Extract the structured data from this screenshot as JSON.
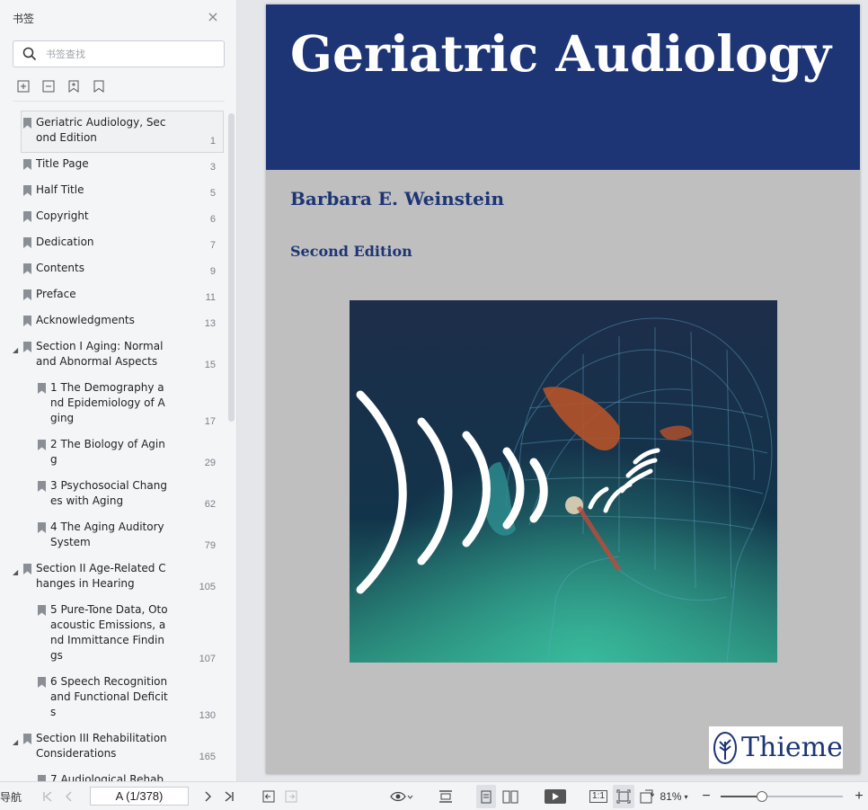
{
  "sidebar": {
    "title": "书签",
    "search_placeholder": "书签查找",
    "bookmarks": [
      {
        "label": "Geriatric Audiology, Second Edition",
        "page": "1",
        "level": 0,
        "selected": true,
        "expandable": false,
        "lines": 2
      },
      {
        "label": "Title Page",
        "page": "3",
        "level": 0,
        "lines": 1
      },
      {
        "label": "Half Title",
        "page": "5",
        "level": 0,
        "lines": 1
      },
      {
        "label": "Copyright",
        "page": "6",
        "level": 0,
        "lines": 1
      },
      {
        "label": "Dedication",
        "page": "7",
        "level": 0,
        "lines": 1
      },
      {
        "label": "Contents",
        "page": "9",
        "level": 0,
        "lines": 1
      },
      {
        "label": "Preface",
        "page": "11",
        "level": 0,
        "lines": 1
      },
      {
        "label": "Acknowledgments",
        "page": "13",
        "level": 0,
        "lines": 1
      },
      {
        "label": "Section I Aging: Normal and Abnormal Aspects",
        "page": "15",
        "level": 0,
        "expandable": true,
        "lines": 2
      },
      {
        "label": "1 The Demography and Epidemiology of Aging",
        "page": "17",
        "level": 1,
        "lines": 3
      },
      {
        "label": "2 The Biology of Aging",
        "page": "29",
        "level": 1,
        "lines": 2
      },
      {
        "label": "3 Psychosocial Changes with Aging",
        "page": "62",
        "level": 1,
        "lines": 2
      },
      {
        "label": "4 The Aging Auditory System",
        "page": "79",
        "level": 1,
        "lines": 2
      },
      {
        "label": "Section II Age-Related Changes in Hearing",
        "page": "105",
        "level": 0,
        "expandable": true,
        "lines": 2
      },
      {
        "label": "5 Pure-Tone Data, Otoacoustic Emissions, and Immittance Findings",
        "page": "107",
        "level": 1,
        "lines": 4
      },
      {
        "label": "6 Speech Recognition and Functional Deficits",
        "page": "130",
        "level": 1,
        "lines": 3
      },
      {
        "label": "Section III Rehabilitation Considerations",
        "page": "165",
        "level": 0,
        "expandable": true,
        "lines": 2
      },
      {
        "label": "7 Audiological Rehab",
        "page": "",
        "level": 1,
        "lines": 2
      }
    ]
  },
  "cover": {
    "title": "Geriatric Audiology",
    "author": "Barbara E. Weinstein",
    "edition": "Second Edition",
    "publisher": "Thieme"
  },
  "toolbar": {
    "nav_label": "导航",
    "page_indicator": "A (1/378)",
    "zoom": "81%",
    "actual_size_label": "1:1"
  },
  "colors": {
    "cover_band": "#1d3575",
    "cover_body": "#bfbfbf",
    "accent": "#1d3575"
  }
}
